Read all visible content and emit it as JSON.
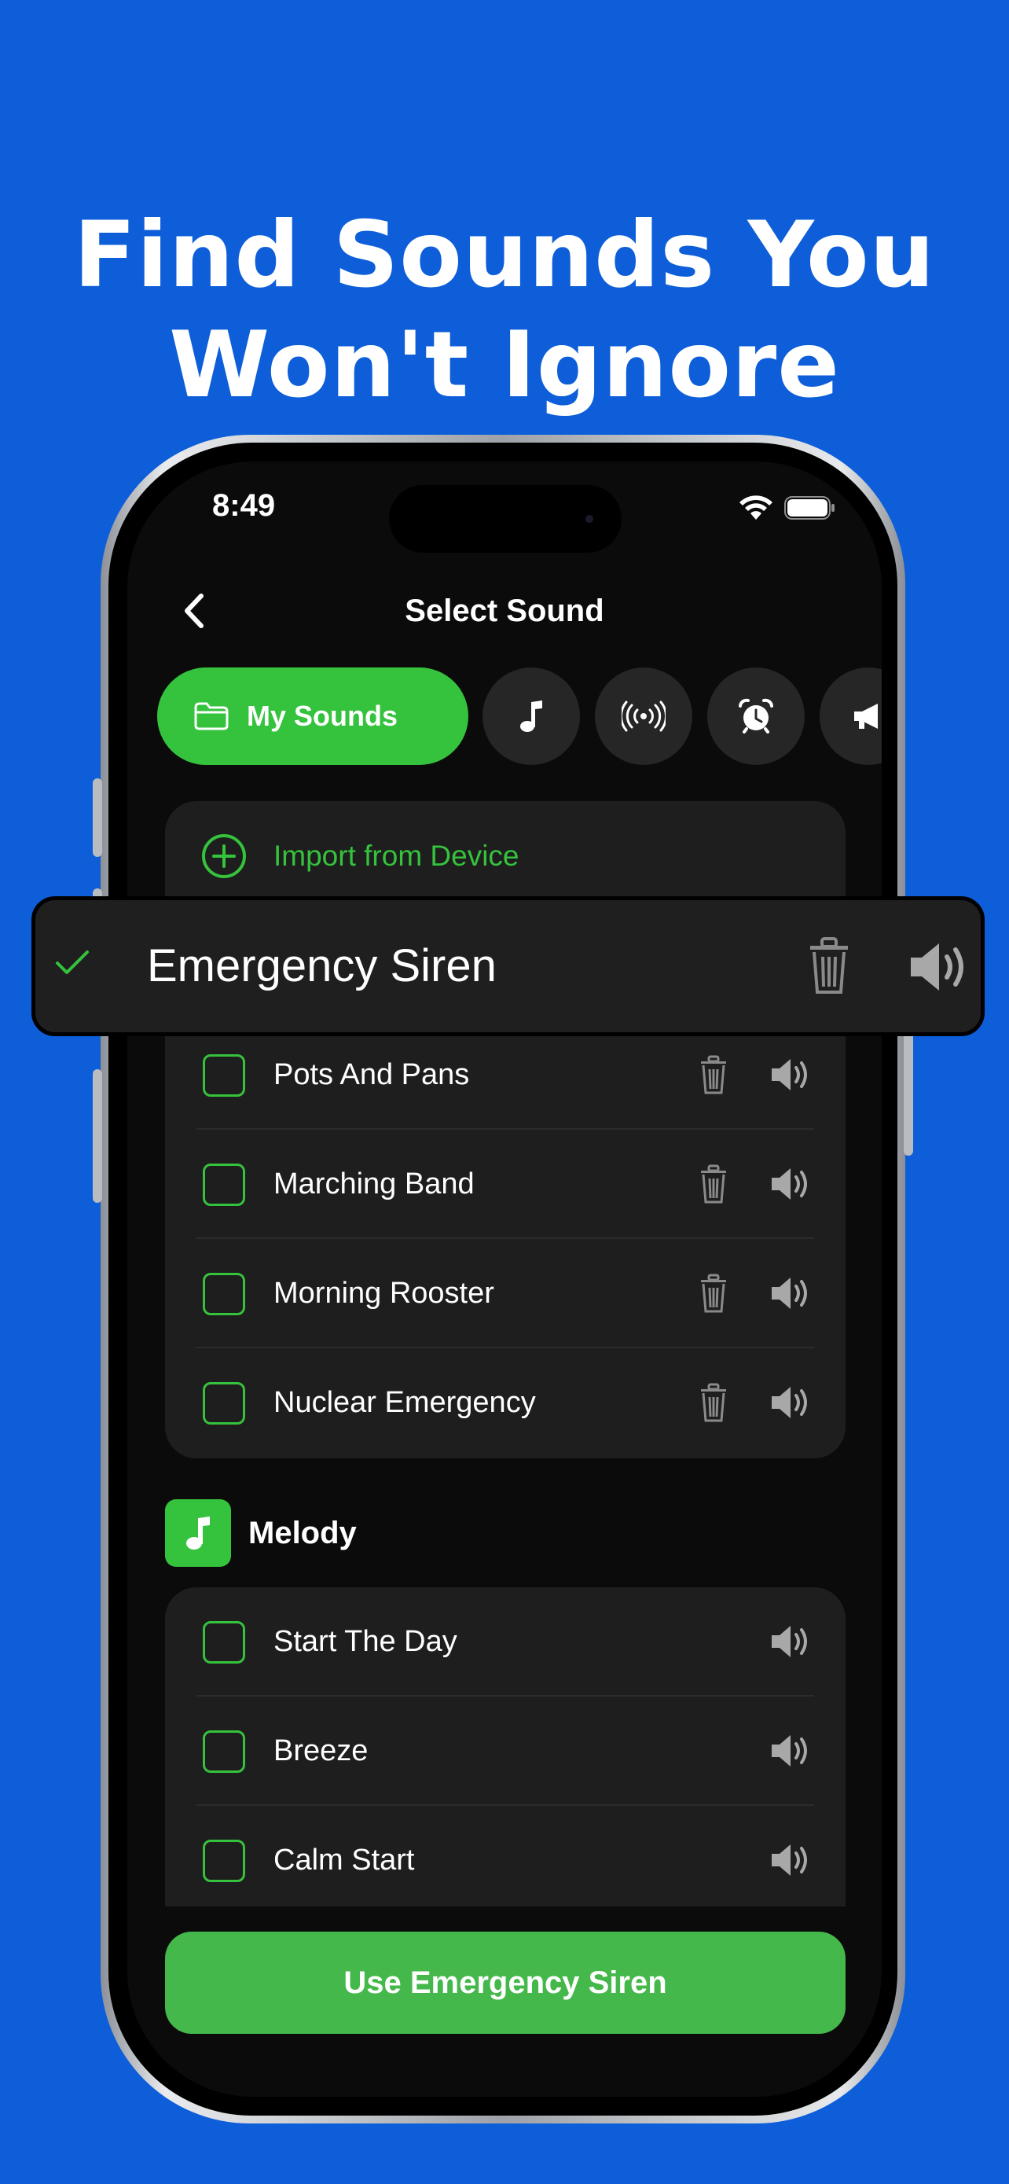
{
  "headline": {
    "line1": "Find Sounds You",
    "line2": "Won't Ignore"
  },
  "status_bar": {
    "time": "8:49"
  },
  "nav": {
    "title": "Select Sound",
    "back_icon": "chevron-left-icon"
  },
  "chips": {
    "primary_label": "My Sounds",
    "icons": [
      "folder-icon",
      "music-note-icon",
      "broadcast-icon",
      "alarm-clock-icon",
      "megaphone-icon"
    ]
  },
  "import": {
    "label": "Import from Device"
  },
  "highlight": {
    "label": "Emergency Siren"
  },
  "my_sounds": [
    {
      "label": "Pots And Pans"
    },
    {
      "label": "Marching Band"
    },
    {
      "label": "Morning Rooster"
    },
    {
      "label": "Nuclear Emergency"
    }
  ],
  "melody": {
    "title": "Melody",
    "items": [
      {
        "label": "Start The Day"
      },
      {
        "label": "Breeze"
      },
      {
        "label": "Calm Start"
      }
    ]
  },
  "cta": {
    "label": "Use Emergency Siren"
  },
  "colors": {
    "background": "#0D5ED8",
    "accent": "#35C23D",
    "card": "#1E1E1E",
    "screen": "#0B0B0B"
  }
}
